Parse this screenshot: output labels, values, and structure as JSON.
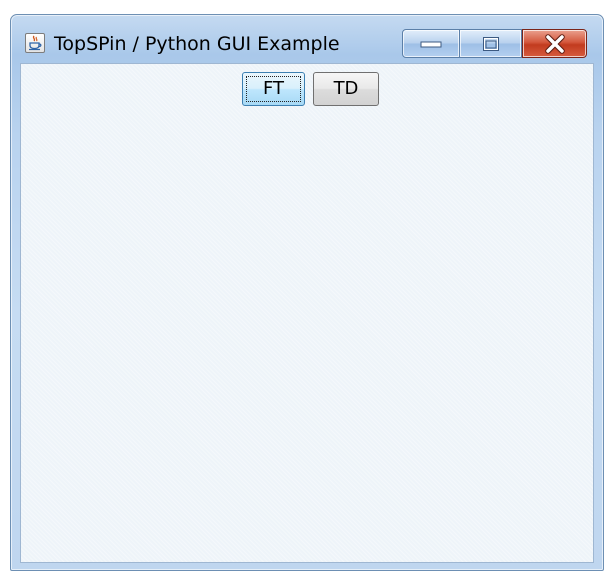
{
  "window": {
    "title": "TopSPin / Python GUI Example",
    "app_icon": "java-coffee-cup-icon",
    "controls": {
      "minimize_icon": "minimize-icon",
      "maximize_icon": "maximize-icon",
      "close_icon": "close-icon"
    }
  },
  "toolbar": {
    "ft_label": "FT",
    "td_label": "TD"
  },
  "colors": {
    "frame": "#b9d3ef",
    "client_background": "#eef4f9",
    "close_button": "#c8442a",
    "focused_button": "#bee6fd"
  }
}
